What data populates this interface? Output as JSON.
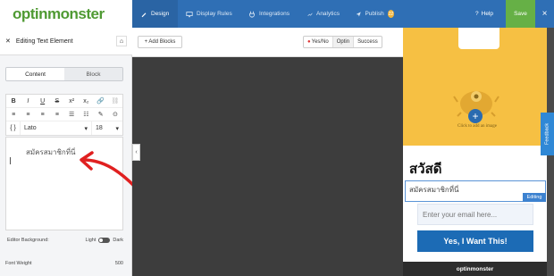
{
  "header": {
    "logo": "optinmonster",
    "tabs": [
      {
        "label": "Design",
        "icon": "brush-icon",
        "active": true
      },
      {
        "label": "Display Rules",
        "icon": "monitor-icon"
      },
      {
        "label": "Integrations",
        "icon": "plug-icon"
      },
      {
        "label": "Analytics",
        "icon": "chart-icon"
      },
      {
        "label": "Publish",
        "icon": "send-icon",
        "badge": "22"
      }
    ],
    "help_label": "Help",
    "save_label": "Save",
    "close_label": "×"
  },
  "sidebar": {
    "title": "Editing Text Element",
    "tabs": [
      {
        "label": "Content",
        "active": true
      },
      {
        "label": "Block"
      }
    ],
    "toolbar_row1": [
      "B",
      "I",
      "U",
      "S",
      "x²",
      "x₂",
      "🔗",
      "⛓"
    ],
    "toolbar_row2": [
      "≡",
      "≡",
      "≡",
      "≡",
      "☰",
      "☷",
      "✎",
      "⊙"
    ],
    "braces": "{ }",
    "font": "Lato",
    "font_size": "18",
    "editor_text": "สมัครสมาชิกที่นี่",
    "editor_bg_label": "Editor Background:",
    "light_label": "Light",
    "dark_label": "Dark",
    "font_weight_label": "Font Weight",
    "font_weight_value": "500"
  },
  "canvas_bar": {
    "add_blocks": "+ Add Blocks",
    "views": [
      {
        "label": "Yes/No",
        "dot": true
      },
      {
        "label": "Optin",
        "active": true
      },
      {
        "label": "Success"
      }
    ]
  },
  "popup": {
    "click_to_add": "Click to add an image",
    "heading": "สวัสดี",
    "subheading": "สมัครสมาชิกที่นี่",
    "editing_badge": "Editing",
    "email_placeholder": "Enter your email here...",
    "cta": "Yes, I Want This!",
    "brand": "optinmonster"
  },
  "feedback_label": "Feedback",
  "colors": {
    "nav_blue": "#2f6fb5",
    "save_green": "#66b046",
    "popup_yellow": "#f6c043",
    "cta_blue": "#1c6bb5",
    "annotation_red": "#e02020"
  }
}
